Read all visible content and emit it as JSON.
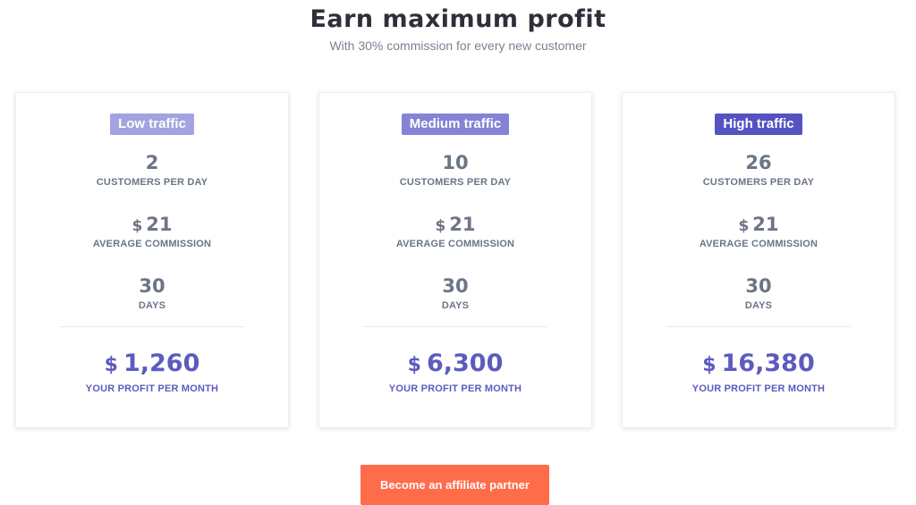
{
  "header": {
    "title": "Earn maximum profit",
    "subtitle": "With 30% commission for every new customer"
  },
  "colors": {
    "badge_low": "#a3a3e0",
    "badge_medium": "#8583d6",
    "badge_high": "#5552c2",
    "profit": "#5d5bbf",
    "cta": "#ff6c4a"
  },
  "plans": [
    {
      "badge": "Low traffic",
      "customers": "2",
      "customers_label": "CUSTOMERS PER DAY",
      "currency": "$",
      "commission": "21",
      "commission_label": "AVERAGE COMMISSION",
      "days": "30",
      "days_label": "DAYS",
      "profit": "1,260",
      "profit_label": "YOUR PROFIT PER MONTH"
    },
    {
      "badge": "Medium traffic",
      "customers": "10",
      "customers_label": "CUSTOMERS PER DAY",
      "currency": "$",
      "commission": "21",
      "commission_label": "AVERAGE COMMISSION",
      "days": "30",
      "days_label": "DAYS",
      "profit": "6,300",
      "profit_label": "YOUR PROFIT PER MONTH"
    },
    {
      "badge": "High traffic",
      "customers": "26",
      "customers_label": "CUSTOMERS PER DAY",
      "currency": "$",
      "commission": "21",
      "commission_label": "AVERAGE COMMISSION",
      "days": "30",
      "days_label": "DAYS",
      "profit": "16,380",
      "profit_label": "YOUR PROFIT PER MONTH"
    }
  ],
  "cta": {
    "label": "Become an affiliate partner"
  }
}
